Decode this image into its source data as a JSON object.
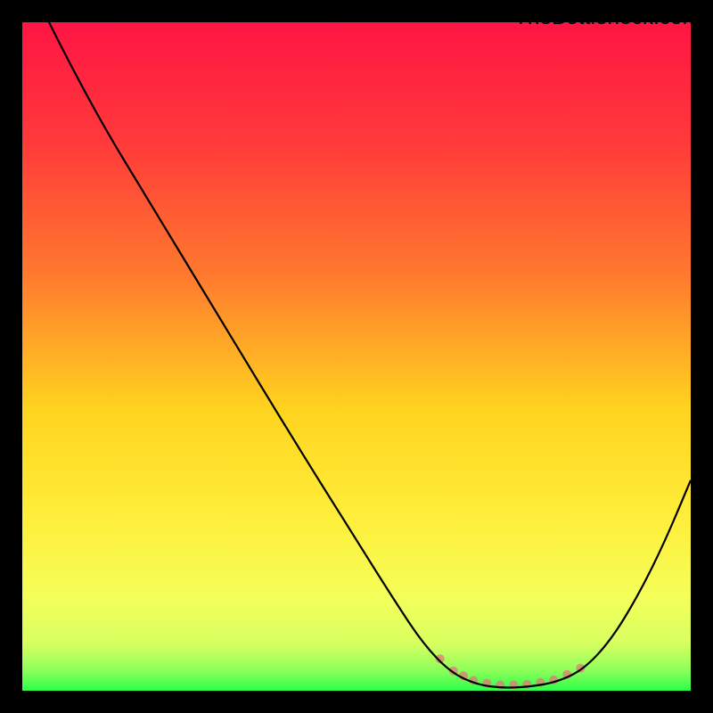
{
  "watermark": "TheBottleneck.com",
  "chart_data": {
    "type": "line",
    "title": "",
    "xlabel": "",
    "ylabel": "",
    "xlim": [
      0,
      100
    ],
    "ylim": [
      0,
      100
    ],
    "gradient_stops": [
      {
        "offset": 0,
        "color": "#ff1544"
      },
      {
        "offset": 18,
        "color": "#ff3a3a"
      },
      {
        "offset": 38,
        "color": "#ff7a2e"
      },
      {
        "offset": 58,
        "color": "#ffd41f"
      },
      {
        "offset": 74,
        "color": "#ffee3a"
      },
      {
        "offset": 86,
        "color": "#f4ff5a"
      },
      {
        "offset": 93,
        "color": "#d7ff60"
      },
      {
        "offset": 97,
        "color": "#8cff5a"
      },
      {
        "offset": 100,
        "color": "#2bff4a"
      }
    ],
    "series": [
      {
        "name": "bottleneck-curve",
        "color": "#000000",
        "width": 2.2,
        "points": [
          {
            "x": 4.0,
            "y": 100.0
          },
          {
            "x": 10.0,
            "y": 88.0
          },
          {
            "x": 20.0,
            "y": 71.5
          },
          {
            "x": 30.0,
            "y": 55.0
          },
          {
            "x": 40.0,
            "y": 38.5
          },
          {
            "x": 50.0,
            "y": 22.5
          },
          {
            "x": 56.0,
            "y": 13.0
          },
          {
            "x": 60.0,
            "y": 7.0
          },
          {
            "x": 64.0,
            "y": 2.8
          },
          {
            "x": 68.0,
            "y": 0.9
          },
          {
            "x": 72.0,
            "y": 0.4
          },
          {
            "x": 76.0,
            "y": 0.6
          },
          {
            "x": 80.0,
            "y": 1.3
          },
          {
            "x": 84.0,
            "y": 3.2
          },
          {
            "x": 88.0,
            "y": 7.5
          },
          {
            "x": 92.0,
            "y": 14.0
          },
          {
            "x": 96.0,
            "y": 22.0
          },
          {
            "x": 100.0,
            "y": 31.5
          }
        ]
      }
    ],
    "marker_band": {
      "name": "green-band-markers",
      "color": "#e27a78",
      "radius": 5,
      "x_values": [
        62.5,
        64.5,
        66.0,
        67.5,
        69.5,
        71.5,
        73.5,
        75.5,
        77.5,
        79.5,
        81.5,
        83.5
      ]
    }
  }
}
